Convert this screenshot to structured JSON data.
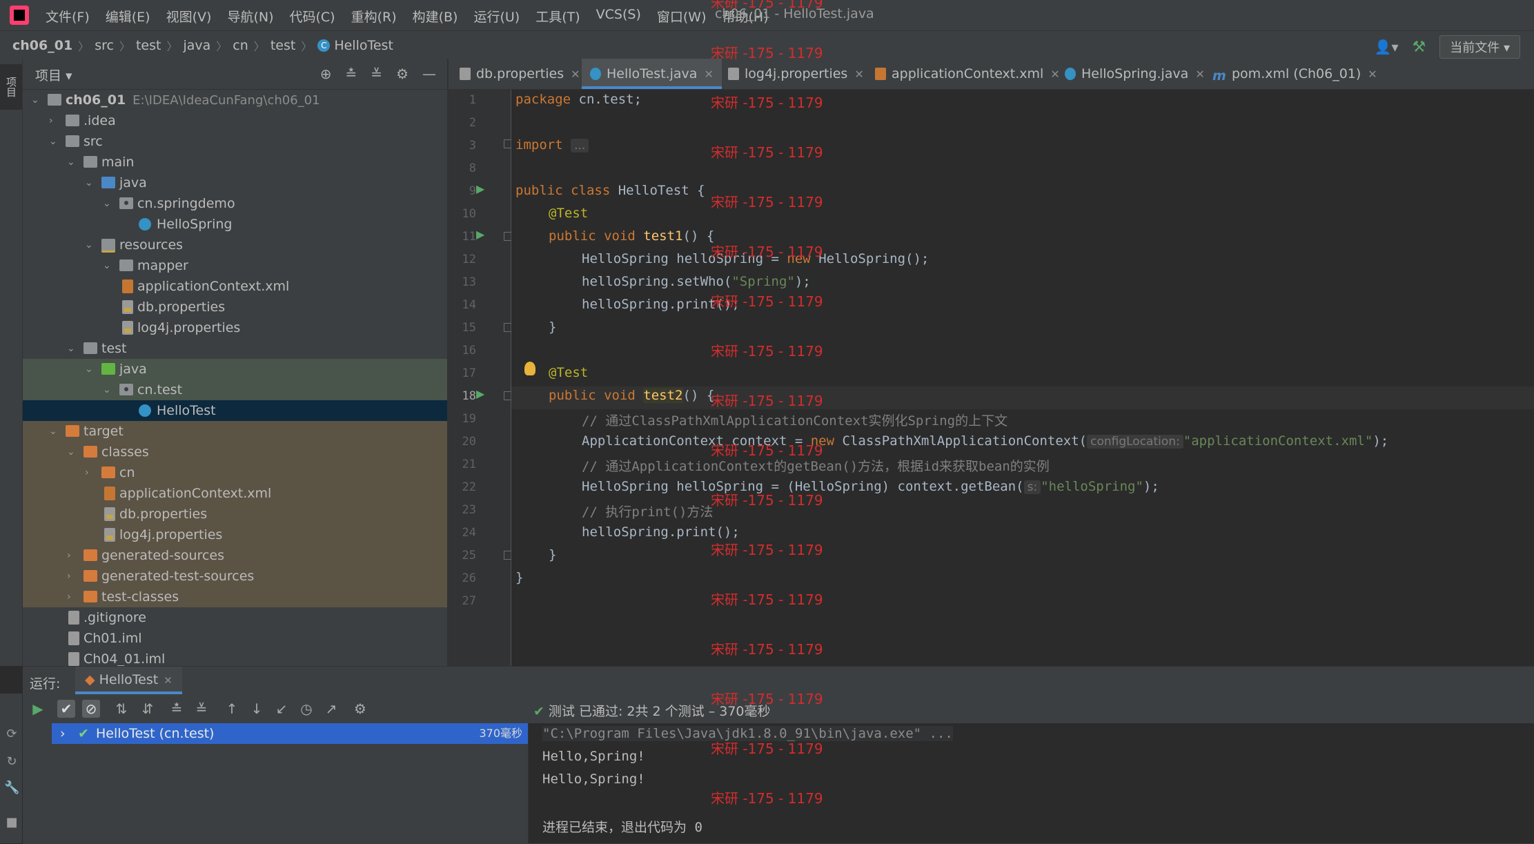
{
  "menubar": {
    "items": [
      "文件(F)",
      "编辑(E)",
      "视图(V)",
      "导航(N)",
      "代码(C)",
      "重构(R)",
      "构建(B)",
      "运行(U)",
      "工具(T)",
      "VCS(S)",
      "窗口(W)",
      "帮助(H)"
    ],
    "window_title": "ch06_01 - HelloTest.java"
  },
  "breadcrumb": [
    "ch06_01",
    "src",
    "test",
    "java",
    "cn",
    "test",
    "HelloTest"
  ],
  "run_config": "当前文件 ▾",
  "left_stripe_tab": "项目",
  "project_panel": {
    "title": "项目 ▾",
    "root_name": "ch06_01",
    "root_path": "E:\\IDEA\\IdeaCunFang\\ch06_01",
    "tree": [
      {
        "label": ".idea",
        "arrow": "›"
      },
      {
        "label": "src",
        "arrow": "⌄"
      },
      {
        "label": "main",
        "arrow": "⌄"
      },
      {
        "label": "java",
        "arrow": "⌄"
      },
      {
        "label": "cn.springdemo",
        "arrow": "⌄"
      },
      {
        "label": "HelloSpring",
        "arrow": ""
      },
      {
        "label": "resources",
        "arrow": "⌄"
      },
      {
        "label": "mapper",
        "arrow": "⌄"
      },
      {
        "label": "applicationContext.xml",
        "arrow": ""
      },
      {
        "label": "db.properties",
        "arrow": ""
      },
      {
        "label": "log4j.properties",
        "arrow": ""
      },
      {
        "label": "test",
        "arrow": "⌄"
      },
      {
        "label": "java",
        "arrow": "⌄"
      },
      {
        "label": "cn.test",
        "arrow": "⌄"
      },
      {
        "label": "HelloTest",
        "arrow": ""
      },
      {
        "label": "target",
        "arrow": "⌄"
      },
      {
        "label": "classes",
        "arrow": "⌄"
      },
      {
        "label": "cn",
        "arrow": "›"
      },
      {
        "label": "applicationContext.xml",
        "arrow": ""
      },
      {
        "label": "db.properties",
        "arrow": ""
      },
      {
        "label": "log4j.properties",
        "arrow": ""
      },
      {
        "label": "generated-sources",
        "arrow": "›"
      },
      {
        "label": "generated-test-sources",
        "arrow": "›"
      },
      {
        "label": "test-classes",
        "arrow": "›"
      },
      {
        "label": ".gitignore",
        "arrow": ""
      },
      {
        "label": "Ch01.iml",
        "arrow": ""
      },
      {
        "label": "Ch04_01.iml",
        "arrow": ""
      }
    ]
  },
  "tabs": [
    {
      "label": "db.properties"
    },
    {
      "label": "HelloTest.java"
    },
    {
      "label": "log4j.properties"
    },
    {
      "label": "applicationContext.xml"
    },
    {
      "label": "HelloSpring.java"
    },
    {
      "label": "pom.xml (Ch06_01)"
    }
  ],
  "code": {
    "line_numbers": [
      "1",
      "2",
      "3",
      "8",
      "9",
      "10",
      "11",
      "12",
      "13",
      "14",
      "15",
      "16",
      "17",
      "18",
      "19",
      "20",
      "21",
      "22",
      "23",
      "24",
      "25",
      "26",
      "27"
    ],
    "l1_kw": "package",
    "l1_rest": " cn.test;",
    "l3_kw": "import",
    "l3_fold": "...",
    "l9_kw": "public class",
    "l9_rest": " HelloTest {",
    "l10": "@Test",
    "l11_kw": "public void",
    "l11_fn": "test1",
    "l11_rest": "() {",
    "l12_a": "HelloSpring helloSpring = ",
    "l12_kw": "new",
    "l12_b": " HelloSpring();",
    "l13_a": "helloSpring.setWho(",
    "l13_str": "\"Spring\"",
    "l13_b": ");",
    "l14": "helloSpring.print();",
    "l15": "}",
    "l17": "@Test",
    "l18_kw": "public void",
    "l18_fn": "test2",
    "l18_rest": "() {",
    "l19": "// 通过ClassPathXmlApplicationContext实例化Spring的上下文",
    "l20_a": "ApplicationContext context = ",
    "l20_kw": "new",
    "l20_b": " ClassPathXmlApplicationContext(",
    "l20_hint": "configLocation:",
    "l20_str": "\"applicationContext.xml\"",
    "l20_c": ");",
    "l21": "// 通过ApplicationContext的getBean()方法，根据id来获取bean的实例",
    "l22_a": "HelloSpring helloSpring = (HelloSpring) context.getBean(",
    "l22_hint": "s:",
    "l22_str": "\"helloSpring\"",
    "l22_c": ");",
    "l23": "// 执行print()方法",
    "l24": "helloSpring.print();",
    "l25": "}",
    "l26": "}"
  },
  "run": {
    "label": "运行:",
    "tab": "HelloTest",
    "status": "测试 已通过: 2共 2 个测试 – 370毫秒",
    "test_row": {
      "name": "HelloTest (cn.test)",
      "time": "370毫秒"
    },
    "console": [
      "\"C:\\Program Files\\Java\\jdk1.8.0_91\\bin\\java.exe\" ...",
      "Hello,Spring!",
      "Hello,Spring!",
      "",
      "进程已结束，退出代码为 0"
    ]
  },
  "watermark": "宋研 -175 - 1179"
}
